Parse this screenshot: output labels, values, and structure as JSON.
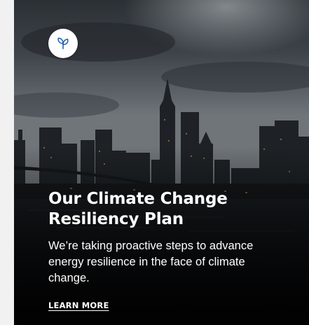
{
  "card": {
    "icon": "leaf-icon",
    "title_line_1": "Our Climate Change",
    "title_line_2": "Resiliency Plan",
    "description": "We’re taking proactive steps to advance energy resilience in the face of climate change.",
    "link_label": "LEARN MORE"
  },
  "colors": {
    "accent": "#1a5fa8",
    "text": "#ffffff",
    "sky": "#3f454b",
    "water": "#0b0d10"
  }
}
